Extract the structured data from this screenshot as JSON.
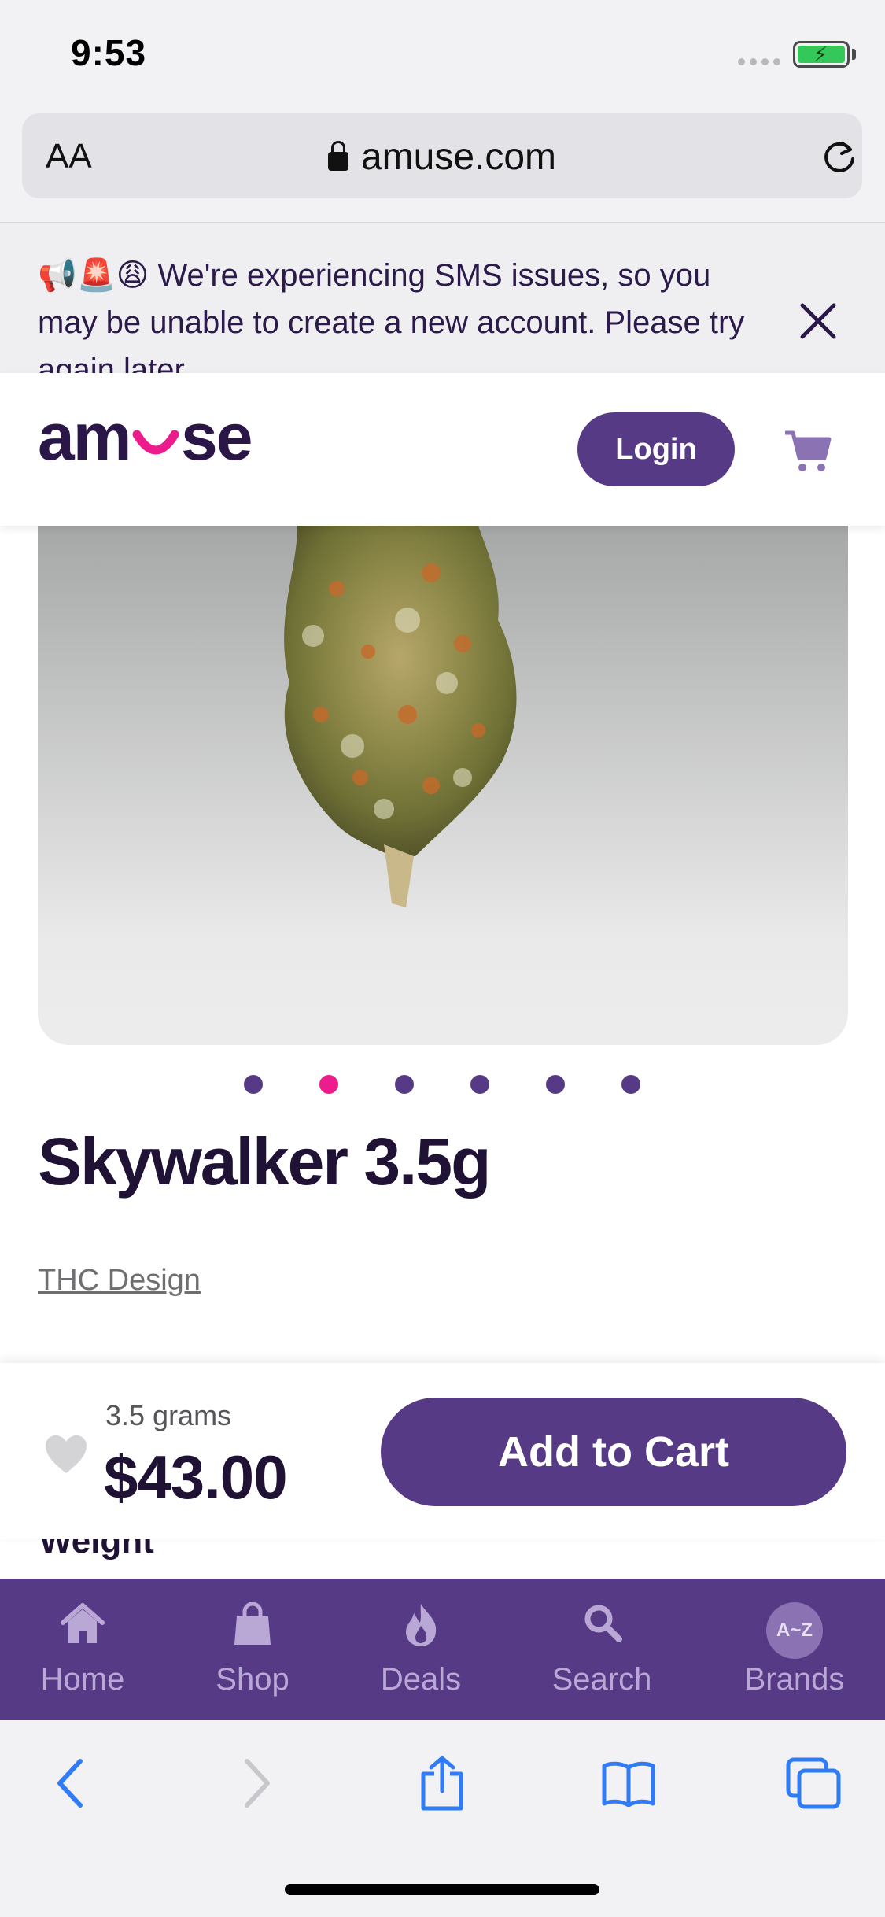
{
  "status_bar": {
    "time": "9:53"
  },
  "browser": {
    "text_size_label": "AA",
    "url": "amuse.com"
  },
  "banner": {
    "emojis": "📢🚨😩",
    "message": "We're experiencing SMS issues, so you may be unable to create a new account. Please try again later."
  },
  "header": {
    "logo": "amuse",
    "login_label": "Login"
  },
  "carousel": {
    "total": 6,
    "active_index": 1
  },
  "product": {
    "title": "Skywalker 3.5g",
    "brand": "THC Design"
  },
  "buy_bar": {
    "size": "3.5 grams",
    "price": "$43.00",
    "add_to_cart_label": "Add to Cart"
  },
  "section": {
    "weight_label": "Weight"
  },
  "tab_nav": {
    "items": [
      {
        "label": "Home",
        "icon": "home-icon"
      },
      {
        "label": "Shop",
        "icon": "shopping-bag-icon"
      },
      {
        "label": "Deals",
        "icon": "flame-icon"
      },
      {
        "label": "Search",
        "icon": "search-icon"
      },
      {
        "label": "Brands",
        "icon": "az-icon",
        "badge": "A~Z"
      }
    ]
  },
  "colors": {
    "brand_purple": "#573a85",
    "accent_pink": "#ec1c8c",
    "text_dark": "#1f1235"
  }
}
